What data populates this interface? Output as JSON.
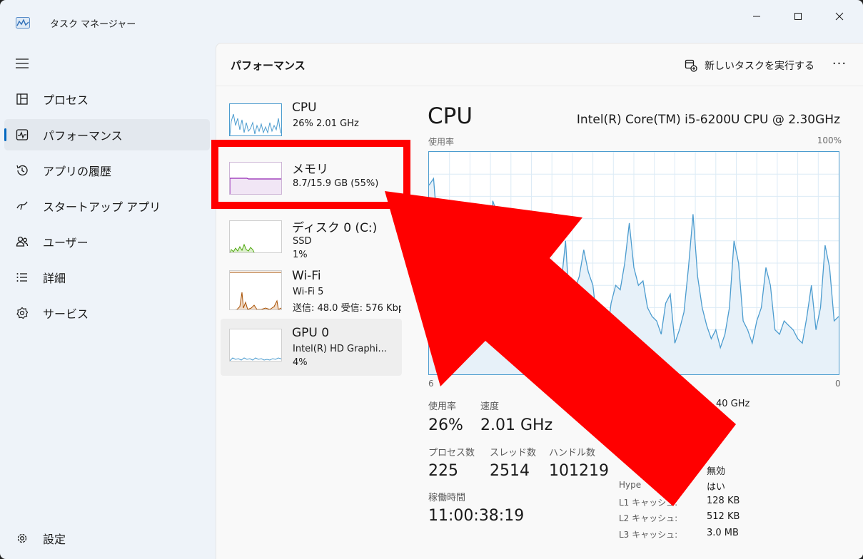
{
  "app": {
    "title": "タスク マネージャー"
  },
  "sidebar": {
    "items": [
      {
        "label": "プロセス",
        "icon": "processes-icon"
      },
      {
        "label": "パフォーマンス",
        "icon": "performance-icon"
      },
      {
        "label": "アプリの履歴",
        "icon": "app-history-icon"
      },
      {
        "label": "スタートアップ アプリ",
        "icon": "startup-icon"
      },
      {
        "label": "ユーザー",
        "icon": "users-icon"
      },
      {
        "label": "詳細",
        "icon": "details-icon"
      },
      {
        "label": "サービス",
        "icon": "services-icon"
      }
    ],
    "settings_label": "設定"
  },
  "header": {
    "title": "パフォーマンス",
    "run_task_label": "新しいタスクを実行する",
    "more_label": "···"
  },
  "perf_list": [
    {
      "title": "CPU",
      "line1": "26%  2.01 GHz",
      "line2": ""
    },
    {
      "title": "メモリ",
      "line1": "8.7/15.9 GB (55%)",
      "line2": ""
    },
    {
      "title": "ディスク 0 (C:)",
      "line1": "SSD",
      "line2": "1%"
    },
    {
      "title": "Wi-Fi",
      "line1": "Wi-Fi 5",
      "line2": "送信: 48.0  受信: 576 Kbps"
    },
    {
      "title": "GPU 0",
      "line1": "Intel(R) HD Graphi...",
      "line2": "4%"
    }
  ],
  "detail": {
    "title": "CPU",
    "model": "Intel(R) Core(TM) i5-6200U CPU @ 2.30GHz",
    "y_label": "使用率",
    "y_max": "100%",
    "x_left": "6",
    "x_right": "0",
    "usage_label": "使用率",
    "usage_value": "26%",
    "speed_label": "速度",
    "speed_value": "2.01 GHz",
    "base_speed_fragment": "40 GHz",
    "processes_label": "プロセス数",
    "processes_value": "225",
    "threads_label": "スレッド数",
    "threads_value": "2514",
    "handles_label": "ハンドル数",
    "handles_value": "101219",
    "uptime_label": "稼働時間",
    "uptime_value": "11:00:38:19",
    "specs": [
      {
        "label": "",
        "value": "無効"
      },
      {
        "label": "Hype",
        "value": "はい"
      },
      {
        "label": "L1 キャッシュ:",
        "value": "128 KB"
      },
      {
        "label": "L2 キャッシュ:",
        "value": "512 KB"
      },
      {
        "label": "L3 キャッシュ:",
        "value": "3.0 MB"
      }
    ]
  },
  "colors": {
    "accent": "#0067c0",
    "cpu_line": "#4c9ccf",
    "memory_line": "#9528b4",
    "disk_line": "#4da60c",
    "wifi_line": "#a74f01",
    "annotation": "#ff0000"
  },
  "cpu_series": [
    85,
    88,
    62,
    60,
    55,
    52,
    58,
    50,
    54,
    60,
    60,
    50,
    46,
    40,
    78,
    72,
    60,
    52,
    48,
    70,
    72,
    46,
    68,
    60,
    40,
    30,
    20,
    18,
    34,
    40,
    60,
    26,
    38,
    44,
    56,
    46,
    40,
    22,
    18,
    16,
    32,
    40,
    38,
    50,
    68,
    48,
    40,
    42,
    30,
    26,
    24,
    18,
    32,
    36,
    14,
    20,
    28,
    48,
    72,
    44,
    30,
    22,
    16,
    20,
    12,
    18,
    30,
    60,
    50,
    24,
    20,
    14,
    24,
    30,
    48,
    40,
    20,
    18,
    24,
    22,
    20,
    16,
    14,
    26,
    40,
    20,
    30,
    58,
    48,
    24,
    26
  ]
}
